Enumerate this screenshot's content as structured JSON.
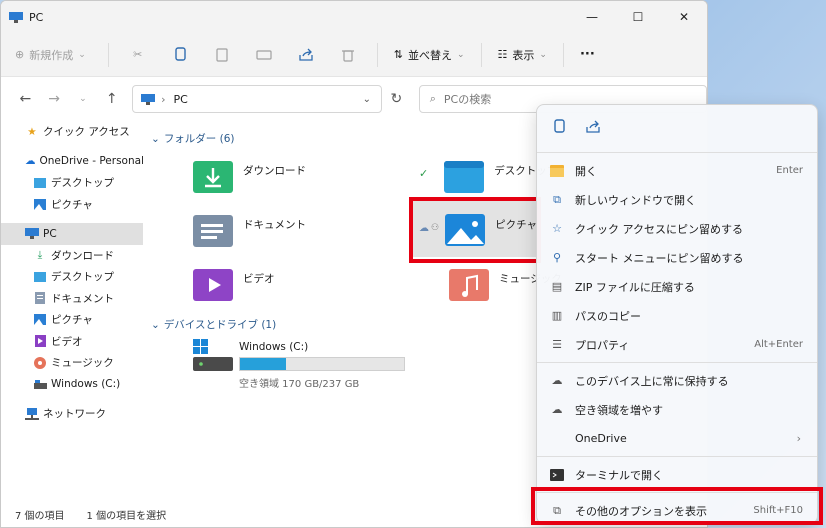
{
  "window": {
    "title": "PC",
    "minimize": "—",
    "maximize": "☐",
    "close": "✕"
  },
  "toolbar": {
    "new_label": "新規作成",
    "sort_label": "並べ替え",
    "view_label": "表示",
    "more": "···"
  },
  "address": {
    "location": "PC",
    "search_placeholder": "PCの検索"
  },
  "sidebar": {
    "items": [
      {
        "label": "クイック アクセス",
        "icon": "star-icon"
      },
      {
        "label": "OneDrive - Personal",
        "icon": "cloud-icon"
      },
      {
        "label": "デスクトップ",
        "icon": "desktop-icon"
      },
      {
        "label": "ピクチャ",
        "icon": "pictures-icon"
      },
      {
        "label": "PC",
        "icon": "pc-icon"
      },
      {
        "label": "ダウンロード",
        "icon": "download-icon"
      },
      {
        "label": "デスクトップ",
        "icon": "desktop-icon"
      },
      {
        "label": "ドキュメント",
        "icon": "documents-icon"
      },
      {
        "label": "ピクチャ",
        "icon": "pictures-icon"
      },
      {
        "label": "ビデオ",
        "icon": "video-icon"
      },
      {
        "label": "ミュージック",
        "icon": "music-icon"
      },
      {
        "label": "Windows (C:)",
        "icon": "drive-icon"
      },
      {
        "label": "ネットワーク",
        "icon": "network-icon"
      }
    ]
  },
  "content": {
    "folders_header": "フォルダー (6)",
    "devices_header": "デバイスとドライブ (1)",
    "folders": [
      {
        "name": "ダウンロード"
      },
      {
        "name": "デスクトップ"
      },
      {
        "name": "ドキュメント"
      },
      {
        "name": "ピクチャ"
      },
      {
        "name": "ビデオ"
      },
      {
        "name": "ミュージック"
      }
    ],
    "drive": {
      "name": "Windows (C:)",
      "free": "空き領域 170 GB/237 GB",
      "used_fraction": 0.28
    }
  },
  "status": {
    "count": "7 個の項目",
    "selected": "1 個の項目を選択"
  },
  "context_menu": {
    "items": [
      {
        "label": "開く",
        "shortcut": "Enter",
        "icon": "open-icon"
      },
      {
        "label": "新しいウィンドウで開く",
        "shortcut": "",
        "icon": "new-window-icon"
      },
      {
        "label": "クイック アクセスにピン留めする",
        "shortcut": "",
        "icon": "pin-star-icon"
      },
      {
        "label": "スタート メニューにピン留めする",
        "shortcut": "",
        "icon": "pin-icon"
      },
      {
        "label": "ZIP ファイルに圧縮する",
        "shortcut": "",
        "icon": "zip-icon"
      },
      {
        "label": "パスのコピー",
        "shortcut": "",
        "icon": "copy-path-icon"
      },
      {
        "label": "プロパティ",
        "shortcut": "Alt+Enter",
        "icon": "properties-icon"
      }
    ],
    "items2": [
      {
        "label": "このデバイス上に常に保持する",
        "icon": "cloud-keep-icon"
      },
      {
        "label": "空き領域を増やす",
        "icon": "cloud-free-icon"
      },
      {
        "label": "OneDrive",
        "icon": ""
      }
    ],
    "terminal": "ターミナルで開く",
    "more_options": "その他のオプションを表示",
    "more_options_shortcut": "Shift+F10"
  },
  "colors": {
    "highlight": "#e60012",
    "accent": "#26a0da"
  }
}
